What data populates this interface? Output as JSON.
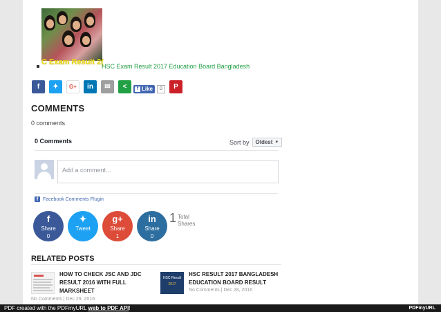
{
  "post": {
    "thumb_caption": "C Exam Result 2(",
    "link_text": "HSC Exam Result 2017 Education Board Bangladesh"
  },
  "share_bar": {
    "buttons": [
      {
        "icon": "facebook-icon",
        "glyph": "f",
        "color": "#3b5998"
      },
      {
        "icon": "twitter-icon",
        "glyph": "✦",
        "color": "#1da1f2"
      },
      {
        "icon": "google-plus-icon",
        "glyph": "G+",
        "color": "#ffffff"
      },
      {
        "icon": "linkedin-icon",
        "glyph": "in",
        "color": "#0077b5"
      },
      {
        "icon": "email-icon",
        "glyph": "✉",
        "color": "#9e9e9e"
      },
      {
        "icon": "share-icon",
        "glyph": "<",
        "color": "#22a045"
      },
      {
        "icon": "pinterest-icon",
        "glyph": "P",
        "color": "#cb2027"
      }
    ],
    "like_label": "Like",
    "like_count": "0"
  },
  "comments": {
    "heading": "COMMENTS",
    "count_text": "0 comments",
    "fb_count": "0 Comments",
    "sort_label": "Sort by",
    "sort_value": "Oldest",
    "input_placeholder": "Add a comment...",
    "plugin_label": "Facebook Comments Plugin"
  },
  "share_circles": [
    {
      "name": "facebook",
      "glyph": "f",
      "label": "Share",
      "count": "0",
      "color": "#3b5998"
    },
    {
      "name": "twitter",
      "glyph": "✦",
      "label": "Tweet",
      "count": "",
      "color": "#1da1f2"
    },
    {
      "name": "google-plus",
      "glyph": "g+",
      "label": "Share",
      "count": "1",
      "color": "#dd4b39"
    },
    {
      "name": "linkedin",
      "glyph": "in",
      "label": "Share",
      "count": "0",
      "color": "#2d6ea0"
    }
  ],
  "totals": {
    "number": "1",
    "label_line1": "Total",
    "label_line2": "Shares"
  },
  "related": {
    "heading": "RELATED POSTS",
    "posts": [
      {
        "title_line1": "HOW TO CHECK JSC AND JDC",
        "title_line2": "RESULT 2016 WITH FULL",
        "title_line3": "MARKSHEET",
        "meta": "No Comments | Dec 29, 2016"
      },
      {
        "title_line1": "HSC RESULT 2017 BANGLADESH",
        "title_line2": "EDUCATION BOARD RESULT",
        "title_line3": "",
        "meta": "No Comments | Dec 28, 2016",
        "thumb_text": "HSC Result",
        "thumb_year": "2017"
      }
    ]
  },
  "footer": {
    "prefix": "PDF created with the PDFmyURL",
    "link": "web to PDF API",
    "suffix": "!",
    "brand": "PDFmyURL"
  }
}
